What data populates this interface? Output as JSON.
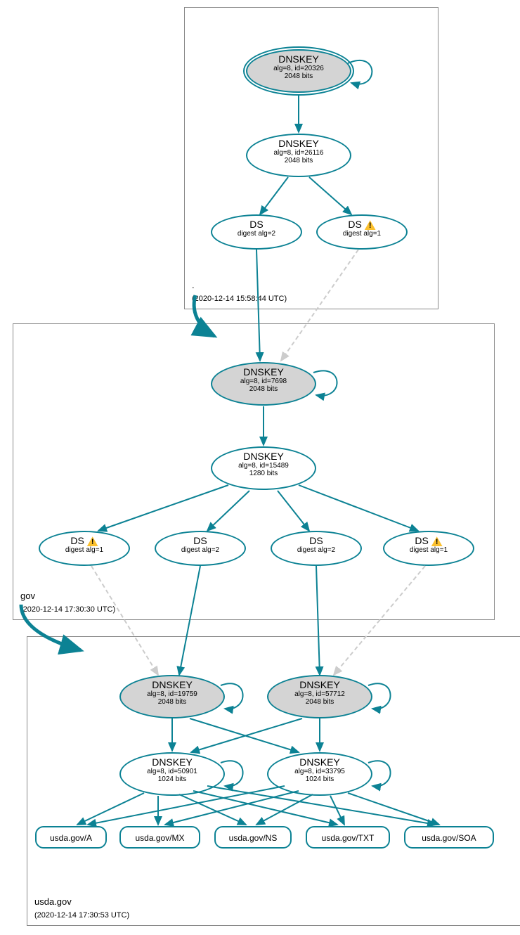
{
  "zones": {
    "root": {
      "label": ".",
      "timestamp": "(2020-12-14 15:58:44 UTC)",
      "nodes": {
        "d20326": {
          "title": "DNSKEY",
          "line1": "alg=8, id=20326",
          "line2": "2048 bits"
        },
        "d26116": {
          "title": "DNSKEY",
          "line1": "alg=8, id=26116",
          "line2": "2048 bits"
        },
        "ds2": {
          "title": "DS",
          "line1": "digest alg=2"
        },
        "ds1": {
          "title": "DS",
          "line1": "digest alg=1",
          "warn": true
        }
      }
    },
    "gov": {
      "label": "gov",
      "timestamp": "(2020-12-14 17:30:30 UTC)",
      "nodes": {
        "d7698": {
          "title": "DNSKEY",
          "line1": "alg=8, id=7698",
          "line2": "2048 bits"
        },
        "d15489": {
          "title": "DNSKEY",
          "line1": "alg=8, id=15489",
          "line2": "1280 bits"
        },
        "dsa1": {
          "title": "DS",
          "line1": "digest alg=1",
          "warn": true
        },
        "dsa2": {
          "title": "DS",
          "line1": "digest alg=2"
        },
        "dsb2": {
          "title": "DS",
          "line1": "digest alg=2"
        },
        "dsb1": {
          "title": "DS",
          "line1": "digest alg=1",
          "warn": true
        }
      }
    },
    "usda": {
      "label": "usda.gov",
      "timestamp": "(2020-12-14 17:30:53 UTC)",
      "nodes": {
        "d19759": {
          "title": "DNSKEY",
          "line1": "alg=8, id=19759",
          "line2": "2048 bits"
        },
        "d57712": {
          "title": "DNSKEY",
          "line1": "alg=8, id=57712",
          "line2": "2048 bits"
        },
        "d50901": {
          "title": "DNSKEY",
          "line1": "alg=8, id=50901",
          "line2": "1024 bits"
        },
        "d33795": {
          "title": "DNSKEY",
          "line1": "alg=8, id=33795",
          "line2": "1024 bits"
        },
        "rA": {
          "title": "usda.gov/A"
        },
        "rMX": {
          "title": "usda.gov/MX"
        },
        "rNS": {
          "title": "usda.gov/NS"
        },
        "rTXT": {
          "title": "usda.gov/TXT"
        },
        "rSOA": {
          "title": "usda.gov/SOA"
        }
      }
    }
  }
}
